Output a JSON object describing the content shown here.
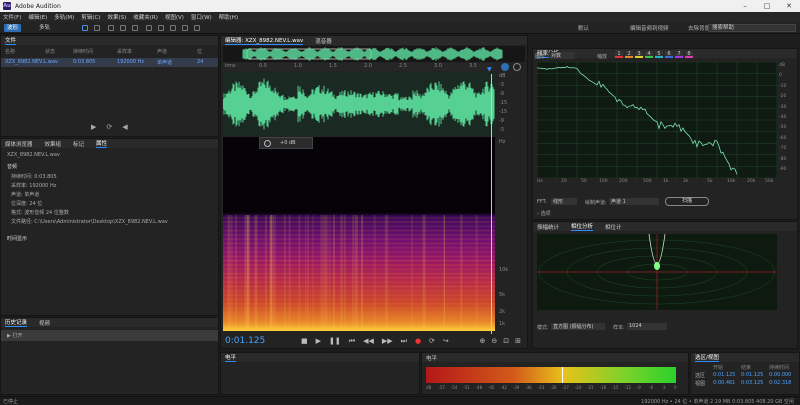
{
  "window": {
    "title": "Adobe Audition",
    "logo": "Au"
  },
  "menu": [
    "文件(F)",
    "编辑(E)",
    "多轨(M)",
    "剪辑(C)",
    "效果(S)",
    "收藏夹(R)",
    "视图(V)",
    "窗口(W)",
    "帮助(H)"
  ],
  "toolbar": {
    "waveform": "波形",
    "multitrack": "多轨",
    "workspaces": [
      "默认",
      "编辑音频到视频",
      "去除背景音乐"
    ],
    "search_placeholder": "搜索帮助"
  },
  "files_panel": {
    "title": "文件",
    "columns": [
      "名称",
      "状态",
      "持续时间",
      "采样率",
      "声道",
      "位"
    ],
    "file": {
      "name": "XZX_8982.NEV.L.wav",
      "duration": "0:03.805",
      "sample_rate": "192000 Hz",
      "channels": "单声道",
      "bits": "24"
    }
  },
  "properties_panel": {
    "tabs": [
      "媒体浏览器",
      "效果组",
      "标记",
      "属性"
    ],
    "filename": "XZX_8982.NEV.L.wav",
    "section": "音频",
    "rows": [
      {
        "k": "持续时间:",
        "v": "0:03.805"
      },
      {
        "k": "采样率:",
        "v": "192000 Hz"
      },
      {
        "k": "声道:",
        "v": "单声道"
      },
      {
        "k": "位深度:",
        "v": "24 位"
      },
      {
        "k": "格式:",
        "v": "波形音频 24 位整数"
      },
      {
        "k": "文件路径:",
        "v": "C:\\Users\\Administrator\\Desktop\\XZX_8982.NEV.L.wav"
      }
    ],
    "more": "时间显示"
  },
  "history_panel": {
    "tabs": [
      "历史记录",
      "视频"
    ],
    "item": "打开"
  },
  "editor": {
    "tabs": [
      "编辑器: XZX_8982.NEV.L.wav",
      "混音器"
    ],
    "ruler": [
      "hms",
      "0.5",
      "1.0",
      "1.5",
      "2.0",
      "2.5",
      "3.0",
      "3.5"
    ],
    "db_scale": [
      "dB",
      "-3",
      "-9",
      "-15",
      "-15",
      "-9",
      "-3"
    ],
    "freq_scale": [
      "Hz",
      "10k",
      "5k",
      "2k",
      "1k"
    ],
    "hud": "+0 dB",
    "time": "0:01.125"
  },
  "levels_panel": {
    "title": "电平",
    "scale": [
      "dB",
      "-57",
      "-54",
      "-51",
      "-48",
      "-45",
      "-42",
      "-39",
      "-36",
      "-33",
      "-30",
      "-27",
      "-24",
      "-21",
      "-18",
      "-15",
      "-12",
      "-9",
      "-6",
      "-3",
      "0"
    ]
  },
  "spectrum_panel": {
    "title": "频率分析",
    "placement_label": "图形",
    "placement_value": "对数",
    "scan_label": "缩放",
    "channels": [
      "1",
      "2",
      "3",
      "4",
      "5",
      "6",
      "7",
      "8"
    ],
    "db_scale": [
      "dB",
      "0",
      "-10",
      "-20",
      "-30",
      "-40",
      "-50",
      "-60",
      "-70",
      "-80",
      "-90",
      "-100"
    ],
    "hz_scale": [
      "Hz",
      "20",
      "50",
      "100",
      "200",
      "500",
      "1k",
      "2k",
      "5k",
      "10k",
      "20k",
      "50k"
    ],
    "fft_label": "FFT:",
    "fft_value": "线形",
    "channel_label": "绘制声道:",
    "channel_value": "声道 1",
    "scan_button": "扫描",
    "options": "选项"
  },
  "phase_panel": {
    "tabs": [
      "振幅统计",
      "相位分析",
      "相位计"
    ],
    "mode_label": "模式:",
    "mode_value": "直方图 (振幅分布)",
    "size_label": "样本:",
    "size_value": "1024"
  },
  "selection_panel": {
    "title": "选区/视图",
    "headers": [
      "开始",
      "结束",
      "持续时间"
    ],
    "rows": [
      {
        "label": "选区",
        "start": "0:01.125",
        "end": "0:01.125",
        "dur": "0:00.000"
      },
      {
        "label": "视图",
        "start": "0:00.461",
        "end": "0:03.125",
        "dur": "0:02.318"
      }
    ]
  },
  "statusbar": {
    "left": "已停止",
    "right": "192000 Hz • 24 位 • 单声道   2.19 MB   0:03.805   408.20 GB 空闲"
  },
  "colors": {
    "accent": "#2d8cff",
    "wave": "#5fe3a1",
    "playhead": "#ffcc33"
  }
}
